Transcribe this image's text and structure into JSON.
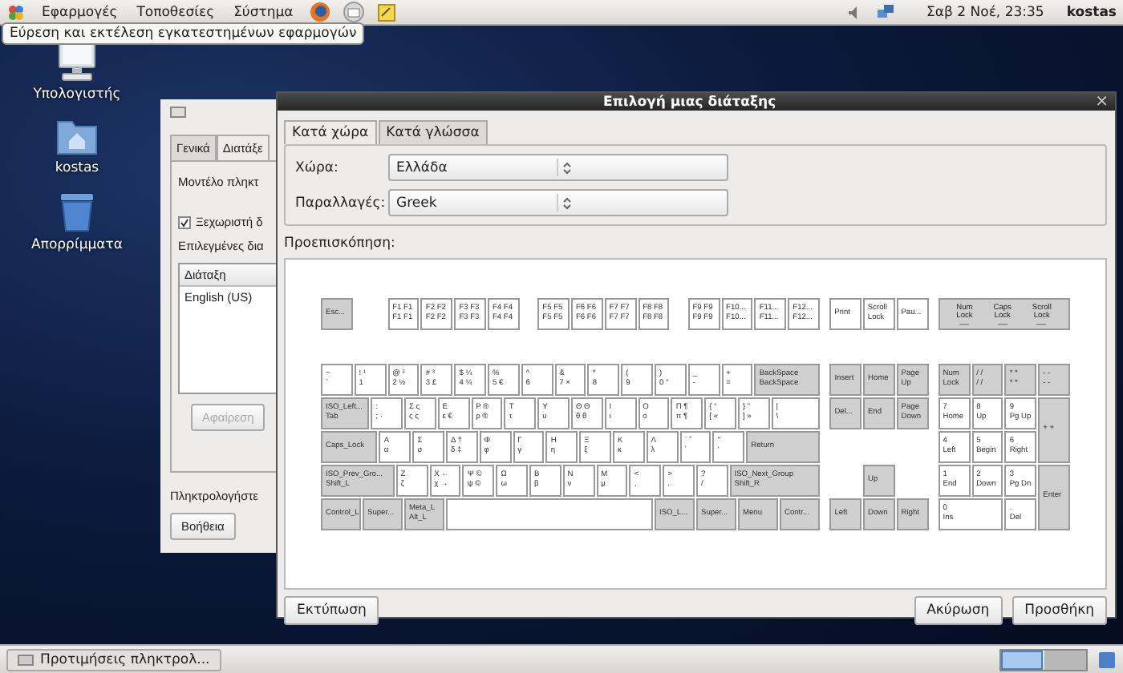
{
  "top_panel": {
    "menus": [
      "Εφαρμογές",
      "Τοποθεσίες",
      "Σύστημα"
    ],
    "clock": "Σαβ 2 Νοέ, 23:35",
    "user": "kostas"
  },
  "tooltip": "Εύρεση και εκτέλεση εγκατεστημένων εφαρμογών",
  "desktop_icons": [
    {
      "label": "Υπολογιστής",
      "kind": "computer"
    },
    {
      "label": "kostas",
      "kind": "home"
    },
    {
      "label": "Απορρίμματα",
      "kind": "trash"
    }
  ],
  "background_window": {
    "tabs": [
      {
        "label": "Γενικά",
        "selected": false
      },
      {
        "label": "Διατάξε",
        "selected": true
      }
    ],
    "model_label": "Μοντέλο πληκτ",
    "separate_option": {
      "label": "Ξεχωριστή δ",
      "checked": true
    },
    "selected_label": "Επιλεγμένες δια",
    "list": {
      "column": "Διάταξη",
      "rows": [
        "English (US)"
      ]
    },
    "remove_button": {
      "label": "Αφαίρεση",
      "disabled": true
    },
    "type_label": "Πληκτρολογήστε",
    "help_button": "Βοήθεια"
  },
  "dialog": {
    "title": "Επιλογή μιας διάταξης",
    "close": "×",
    "tabs": [
      {
        "label": "Κατά χώρα",
        "selected": true
      },
      {
        "label": "Κατά γλώσσα",
        "selected": false
      }
    ],
    "country": {
      "label": "Χώρα:",
      "value": "Ελλάδα"
    },
    "variant": {
      "label": "Παραλλαγές:",
      "value": "Greek"
    },
    "preview_label": "Προεπισκόπηση:",
    "keyboard": {
      "escape": {
        "lines": [
          "Esc..."
        ],
        "kind": "mod"
      },
      "f_groups": [
        [
          {
            "lines": [
              "F1 F1",
              "F1 F1"
            ],
            "kind": "char"
          },
          {
            "lines": [
              "F2 F2",
              "F2 F2"
            ],
            "kind": "char"
          },
          {
            "lines": [
              "F3 F3",
              "F3 F3"
            ],
            "kind": "char"
          },
          {
            "lines": [
              "F4 F4",
              "F4 F4"
            ],
            "kind": "char"
          }
        ],
        [
          {
            "lines": [
              "F5 F5",
              "F5 F5"
            ],
            "kind": "char"
          },
          {
            "lines": [
              "F6 F6",
              "F6 F6"
            ],
            "kind": "char"
          },
          {
            "lines": [
              "F7 F7",
              "F7 F7"
            ],
            "kind": "char"
          },
          {
            "lines": [
              "F8 F8",
              "F8 F8"
            ],
            "kind": "char"
          }
        ],
        [
          {
            "lines": [
              "F9 F9",
              "F9 F9"
            ],
            "kind": "char"
          },
          {
            "lines": [
              "F10...",
              "F10..."
            ],
            "kind": "char"
          },
          {
            "lines": [
              "F11...",
              "F11..."
            ],
            "kind": "char"
          },
          {
            "lines": [
              "F12...",
              "F12..."
            ],
            "kind": "char"
          }
        ]
      ],
      "system_keys": [
        {
          "lines": [
            "Print"
          ],
          "kind": "char"
        },
        {
          "lines": [
            "Scroll",
            "Lock"
          ],
          "kind": "char"
        },
        {
          "lines": [
            "Pau..."
          ],
          "kind": "char"
        }
      ],
      "indicators": [
        {
          "lines": [
            "Num",
            "Lock"
          ]
        },
        {
          "lines": [
            "Caps",
            "Lock"
          ]
        },
        {
          "lines": [
            "Scroll",
            "Lock"
          ]
        }
      ],
      "main_rows": [
        [
          {
            "lines": [
              "~",
              "`"
            ],
            "kind": "char"
          },
          {
            "lines": [
              "! ¹",
              "1"
            ],
            "kind": "char"
          },
          {
            "lines": [
              "@ ²",
              "2 ½"
            ],
            "kind": "char"
          },
          {
            "lines": [
              "# ³",
              "3 £"
            ],
            "kind": "char"
          },
          {
            "lines": [
              "$ ¼",
              "4 ¼"
            ],
            "kind": "char"
          },
          {
            "lines": [
              "%",
              "5 €"
            ],
            "kind": "char"
          },
          {
            "lines": [
              "^",
              "6"
            ],
            "kind": "char"
          },
          {
            "lines": [
              "&",
              "7 ×"
            ],
            "kind": "char"
          },
          {
            "lines": [
              "*",
              "8"
            ],
            "kind": "char"
          },
          {
            "lines": [
              "(",
              "9"
            ],
            "kind": "char"
          },
          {
            "lines": [
              ")",
              "0 °"
            ],
            "kind": "char"
          },
          {
            "lines": [
              "_",
              "-"
            ],
            "kind": "char"
          },
          {
            "lines": [
              "+",
              "="
            ],
            "kind": "char"
          },
          {
            "lines": [
              "BackSpace",
              "BackSpace"
            ],
            "kind": "mod"
          }
        ],
        [
          {
            "lines": [
              "ISO_Left...",
              "Tab"
            ],
            "kind": "mod"
          },
          {
            "lines": [
              ":",
              "; ·"
            ],
            "kind": "char"
          },
          {
            "lines": [
              "Σ ς",
              "ς ς"
            ],
            "kind": "char"
          },
          {
            "lines": [
              "Ε",
              "ε €"
            ],
            "kind": "char"
          },
          {
            "lines": [
              "Ρ ®",
              "ρ ®"
            ],
            "kind": "char"
          },
          {
            "lines": [
              "Τ",
              "τ"
            ],
            "kind": "char"
          },
          {
            "lines": [
              "Υ",
              "υ"
            ],
            "kind": "char"
          },
          {
            "lines": [
              "Θ Θ",
              "θ θ"
            ],
            "kind": "char"
          },
          {
            "lines": [
              "Ι",
              "ι"
            ],
            "kind": "char"
          },
          {
            "lines": [
              "Ο",
              "ο"
            ],
            "kind": "char"
          },
          {
            "lines": [
              "Π ¶",
              "π ¶"
            ],
            "kind": "char"
          },
          {
            "lines": [
              "{ “",
              "[ «"
            ],
            "kind": "char"
          },
          {
            "lines": [
              "} ”",
              "] »"
            ],
            "kind": "char"
          },
          {
            "lines": [
              "|",
              "\\"
            ],
            "kind": "char"
          }
        ],
        [
          {
            "lines": [
              "Caps_Lock"
            ],
            "kind": "mod"
          },
          {
            "lines": [
              "Α",
              "α"
            ],
            "kind": "char"
          },
          {
            "lines": [
              "Σ",
              "σ"
            ],
            "kind": "char"
          },
          {
            "lines": [
              "Δ †",
              "δ ‡"
            ],
            "kind": "char"
          },
          {
            "lines": [
              "Φ",
              "φ"
            ],
            "kind": "char"
          },
          {
            "lines": [
              "Γ",
              "γ"
            ],
            "kind": "char"
          },
          {
            "lines": [
              "Η",
              "η"
            ],
            "kind": "char"
          },
          {
            "lines": [
              "Ξ",
              "ξ"
            ],
            "kind": "char"
          },
          {
            "lines": [
              "Κ",
              "κ"
            ],
            "kind": "char"
          },
          {
            "lines": [
              "Λ",
              "λ"
            ],
            "kind": "char"
          },
          {
            "lines": [
              "¨ ΅",
              "΄"
            ],
            "kind": "char"
          },
          {
            "lines": [
              "\"",
              "'"
            ],
            "kind": "char"
          },
          {
            "lines": [
              "Return"
            ],
            "kind": "mod"
          }
        ],
        [
          {
            "lines": [
              "ISO_Prev_Gro...",
              "Shift_L"
            ],
            "kind": "mod"
          },
          {
            "lines": [
              "Ζ",
              "ζ"
            ],
            "kind": "char"
          },
          {
            "lines": [
              "Χ ←",
              "χ →"
            ],
            "kind": "char"
          },
          {
            "lines": [
              "Ψ ©",
              "ψ ©"
            ],
            "kind": "char"
          },
          {
            "lines": [
              "Ω",
              "ω"
            ],
            "kind": "char"
          },
          {
            "lines": [
              "Β",
              "β"
            ],
            "kind": "char"
          },
          {
            "lines": [
              "Ν",
              "ν"
            ],
            "kind": "char"
          },
          {
            "lines": [
              "Μ",
              "μ"
            ],
            "kind": "char"
          },
          {
            "lines": [
              "<",
              ","
            ],
            "kind": "char"
          },
          {
            "lines": [
              ">",
              "."
            ],
            "kind": "char"
          },
          {
            "lines": [
              "?",
              "/"
            ],
            "kind": "char"
          },
          {
            "lines": [
              "ISO_Next_Group",
              "Shift_R"
            ],
            "kind": "mod"
          }
        ],
        [
          {
            "lines": [
              "Control_L"
            ],
            "kind": "mod"
          },
          {
            "lines": [
              "Super..."
            ],
            "kind": "mod"
          },
          {
            "lines": [
              "Meta_L",
              "Alt_L"
            ],
            "kind": "mod"
          },
          {
            "kind": "space"
          },
          {
            "lines": [
              "ISO_L..."
            ],
            "kind": "mod"
          },
          {
            "lines": [
              "Super..."
            ],
            "kind": "mod"
          },
          {
            "lines": [
              "Menu"
            ],
            "kind": "mod"
          },
          {
            "lines": [
              "Contr..."
            ],
            "kind": "mod"
          }
        ]
      ],
      "navigation": [
        {
          "lines": [
            "Insert"
          ],
          "kind": "mod"
        },
        {
          "lines": [
            "Home"
          ],
          "kind": "mod"
        },
        {
          "lines": [
            "Page",
            "Up"
          ],
          "kind": "mod"
        },
        {
          "lines": [
            "Del..."
          ],
          "kind": "mod"
        },
        {
          "lines": [
            "End"
          ],
          "kind": "mod"
        },
        {
          "lines": [
            "Page",
            "Down"
          ],
          "kind": "mod"
        },
        {
          "lines": [
            "Up"
          ],
          "kind": "mod"
        },
        {
          "lines": [
            "Left"
          ],
          "kind": "mod"
        },
        {
          "lines": [
            "Down"
          ],
          "kind": "mod"
        },
        {
          "lines": [
            "Right"
          ],
          "kind": "mod"
        }
      ],
      "numpad": [
        {
          "lines": [
            "Num",
            "Lock"
          ],
          "kind": "mod"
        },
        {
          "lines": [
            "/ /",
            "/ /"
          ],
          "kind": "mod"
        },
        {
          "lines": [
            "* *",
            "* *"
          ],
          "kind": "mod"
        },
        {
          "lines": [
            "- -",
            "- -"
          ],
          "kind": "mod"
        },
        {
          "lines": [
            "7",
            "Home"
          ],
          "kind": "char"
        },
        {
          "lines": [
            "8",
            "Up"
          ],
          "kind": "char"
        },
        {
          "lines": [
            "9",
            "Pg Up"
          ],
          "kind": "char"
        },
        {
          "lines": [
            "+ +"
          ],
          "kind": "mod"
        },
        {
          "lines": [
            "4",
            "Left"
          ],
          "kind": "char"
        },
        {
          "lines": [
            "5",
            "Begin"
          ],
          "kind": "char"
        },
        {
          "lines": [
            "6",
            "Right"
          ],
          "kind": "char"
        },
        {
          "lines": [
            "1",
            "End"
          ],
          "kind": "char"
        },
        {
          "lines": [
            "2",
            "Down"
          ],
          "kind": "char"
        },
        {
          "lines": [
            "3",
            "Pg Dn"
          ],
          "kind": "char"
        },
        {
          "lines": [
            "Enter"
          ],
          "kind": "mod"
        },
        {
          "lines": [
            "0",
            "Ins"
          ],
          "kind": "char"
        },
        {
          "lines": [
            ".",
            "Del"
          ],
          "kind": "char"
        }
      ]
    },
    "print_button": "Εκτύπωση",
    "cancel_button": "Ακύρωση",
    "add_button": "Προσθήκη"
  },
  "bottom_panel": {
    "task": "Προτιμήσεις πληκτρολ...",
    "workspaces": [
      {
        "selected": true
      },
      {
        "selected": false
      }
    ]
  }
}
